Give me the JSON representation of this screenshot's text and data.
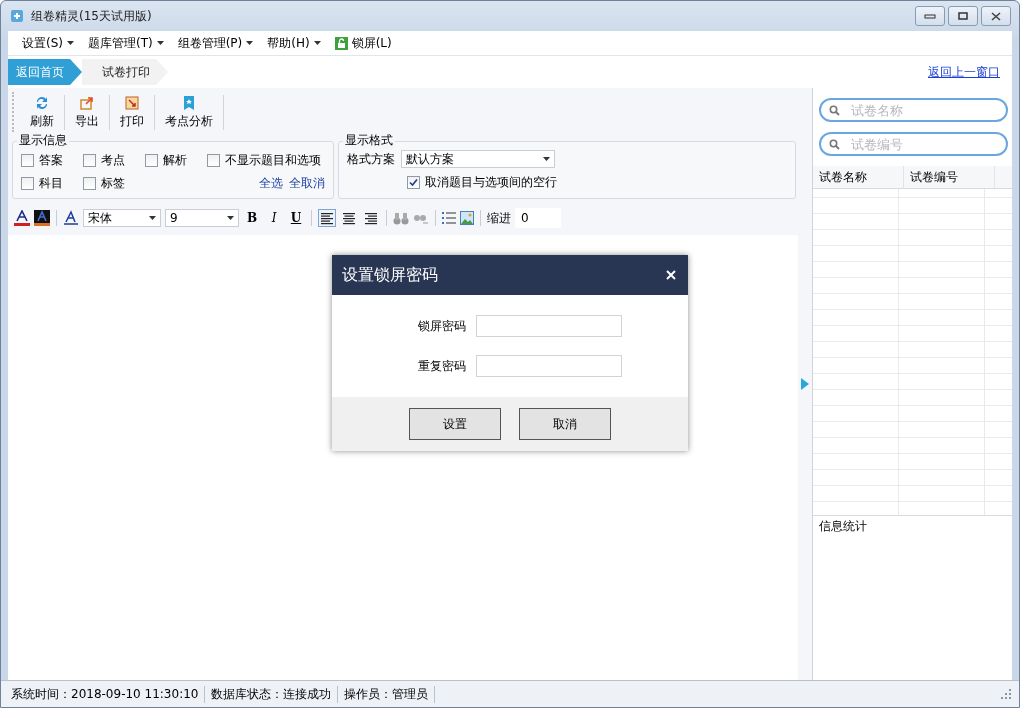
{
  "window": {
    "title": "组卷精灵(15天试用版)"
  },
  "menu": [
    {
      "label": "设置(S)",
      "kind": "dropdown"
    },
    {
      "label": "题库管理(T)",
      "kind": "dropdown"
    },
    {
      "label": "组卷管理(P)",
      "kind": "dropdown"
    },
    {
      "label": "帮助(H)",
      "kind": "dropdown"
    },
    {
      "label": "锁屏(L)",
      "kind": "lock"
    }
  ],
  "breadcrumb": [
    {
      "label": "返回首页",
      "selected": true
    },
    {
      "label": "试卷打印",
      "selected": false
    }
  ],
  "back_link": "返回上一窗口",
  "toolbar": [
    {
      "label": "刷新",
      "kind": "refresh"
    },
    {
      "label": "导出",
      "kind": "export"
    },
    {
      "label": "打印",
      "kind": "print"
    },
    {
      "label": "考点分析",
      "kind": "analysis"
    }
  ],
  "display_info": {
    "title": "显示信息",
    "options": [
      {
        "label": "答案",
        "checked": false
      },
      {
        "label": "考点",
        "checked": false
      },
      {
        "label": "解析",
        "checked": false
      },
      {
        "label": "不显示题目和选项",
        "checked": false
      },
      {
        "label": "科目",
        "checked": false
      },
      {
        "label": "标签",
        "checked": false
      }
    ],
    "links": [
      "全选",
      "全取消"
    ]
  },
  "display_format": {
    "title": "显示格式",
    "scheme_label": "格式方案",
    "scheme_value": "默认方案",
    "option": {
      "label": "取消题目与选项间的空行",
      "checked": true
    }
  },
  "format_bar": {
    "font": "宋体",
    "size": "9",
    "style_buttons": [
      "B",
      "I",
      "U"
    ],
    "align": [
      {
        "selected": true
      },
      {
        "selected": false
      },
      {
        "selected": false
      }
    ],
    "indent_label": "缩进",
    "indent_value": "0"
  },
  "search_fields": [
    {
      "placeholder": "试卷名称"
    },
    {
      "placeholder": "试卷编号"
    }
  ],
  "paper_table": {
    "columns": [
      "试卷名称",
      "试卷编号"
    ]
  },
  "info_stats": {
    "title": "信息统计"
  },
  "dialog": {
    "title": "设置锁屏密码",
    "fields": [
      {
        "label": "锁屏密码"
      },
      {
        "label": "重复密码"
      }
    ],
    "buttons": [
      "设置",
      "取消"
    ]
  },
  "status_bar": [
    "系统时间：2018-09-10 11:30:10",
    "数据库状态：连接成功",
    "操作员：管理员"
  ]
}
